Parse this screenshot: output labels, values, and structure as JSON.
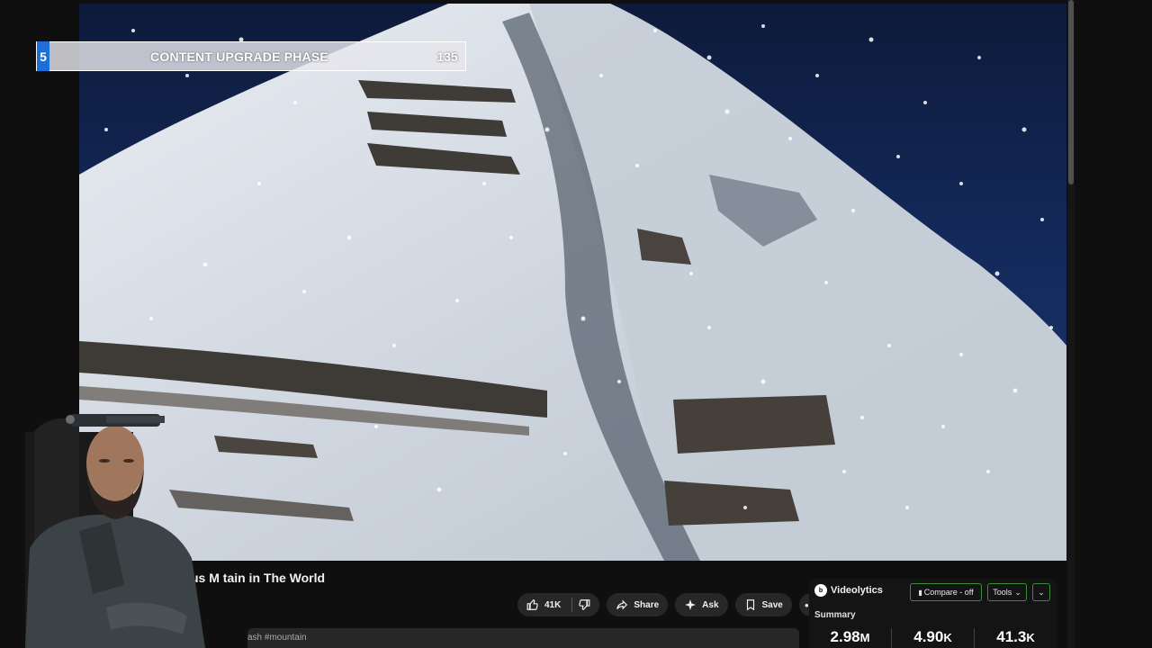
{
  "overlay": {
    "step": "5",
    "phase": "CONTENT UPGRADE PHASE",
    "count": "135"
  },
  "video": {
    "title": "us M    tain in The World",
    "hashtag": "ash #mountain"
  },
  "actions": {
    "like_count": "41K",
    "share_label": "Share",
    "ask_label": "Ask",
    "save_label": "Save",
    "more_label": "•••"
  },
  "videolytics": {
    "brand": "Videolytics",
    "logo_text": "b",
    "compare_label": "Compare - off",
    "tools_label": "Tools",
    "summary_label": "Summary",
    "stats": [
      {
        "value": "2.98",
        "unit": "M"
      },
      {
        "value": "4.90",
        "unit": "K"
      },
      {
        "value": "41.3",
        "unit": "K"
      }
    ]
  },
  "icons": {
    "like": "thumbs-up-icon",
    "dislike": "thumbs-down-icon",
    "share": "share-arrow-icon",
    "ask": "sparkle-icon",
    "save": "bookmark-icon"
  }
}
